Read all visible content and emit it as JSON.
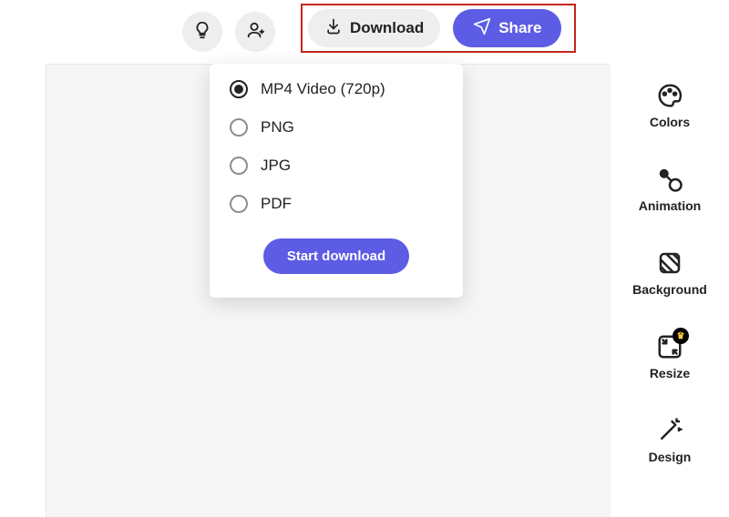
{
  "toolbar": {
    "download_label": "Download",
    "share_label": "Share"
  },
  "download_menu": {
    "options": [
      {
        "label": "MP4 Video (720p)",
        "checked": true
      },
      {
        "label": "PNG",
        "checked": false
      },
      {
        "label": "JPG",
        "checked": false
      },
      {
        "label": "PDF",
        "checked": false
      }
    ],
    "start_label": "Start download"
  },
  "rail": {
    "items": [
      {
        "label": "Colors"
      },
      {
        "label": "Animation"
      },
      {
        "label": "Background"
      },
      {
        "label": "Resize"
      },
      {
        "label": "Design"
      }
    ]
  }
}
